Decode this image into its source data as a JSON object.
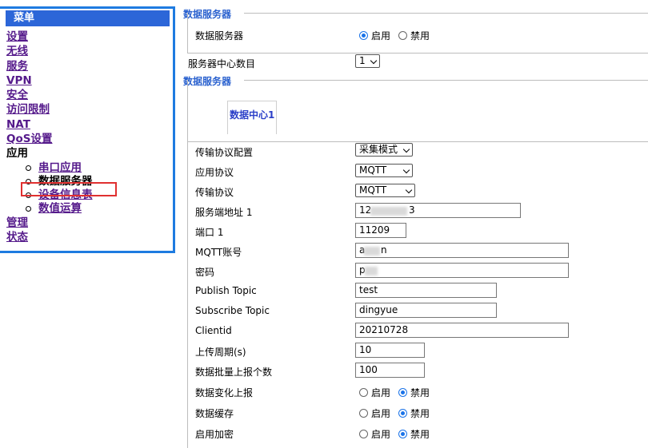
{
  "menu": {
    "title": "菜单",
    "items": [
      {
        "label": "设置"
      },
      {
        "label": "无线"
      },
      {
        "label": "服务"
      },
      {
        "label": "VPN"
      },
      {
        "label": "安全"
      },
      {
        "label": "访问限制"
      },
      {
        "label": "NAT"
      },
      {
        "label": "QoS设置"
      },
      {
        "label": "应用"
      }
    ],
    "sub_items": [
      {
        "label": "串口应用"
      },
      {
        "label": "数据服务器"
      },
      {
        "label": "设备信息表"
      },
      {
        "label": "数值运算"
      }
    ],
    "bottom_items": [
      {
        "label": "管理"
      },
      {
        "label": "状态"
      }
    ]
  },
  "section1": {
    "legend": "数据服务器",
    "server_label": "数据服务器",
    "enable_label": "启用",
    "disable_label": "禁用"
  },
  "center_count": {
    "label": "服务器中心数目",
    "value": "1"
  },
  "section2": {
    "legend": "数据服务器",
    "tab": "数据中心1"
  },
  "form": {
    "transport_config": {
      "label": "传输协议配置",
      "value": "采集模式"
    },
    "app_protocol": {
      "label": "应用协议",
      "value": "MQTT"
    },
    "transport_protocol": {
      "label": "传输协议",
      "value": "MQTT"
    },
    "server_address": {
      "label": "服务端地址 1",
      "value_start": "12",
      "value_end": "3"
    },
    "port": {
      "label": "端口 1",
      "value": "11209"
    },
    "mqtt_account": {
      "label": "MQTT账号",
      "value_start": "a",
      "value_end": "n"
    },
    "password": {
      "label": "密码",
      "value_start": "p"
    },
    "publish_topic": {
      "label": "Publish Topic",
      "value": "test"
    },
    "subscribe_topic": {
      "label": "Subscribe Topic",
      "value": "dingyue"
    },
    "clientid": {
      "label": "Clientid",
      "value": "20210728"
    },
    "upload_period": {
      "label": "上传周期(s)",
      "value": "10"
    },
    "batch_count": {
      "label": "数据批量上报个数",
      "value": "100"
    },
    "change_report": {
      "label": "数据变化上报"
    },
    "data_cache": {
      "label": "数据缓存"
    },
    "encryption": {
      "label": "启用加密"
    },
    "enable_label": "启用",
    "disable_label": "禁用"
  },
  "colors": {
    "menu_border": "#1e7be0",
    "menu_header": "#2c66d8",
    "legend": "#2b62cf",
    "highlight": "#e03030",
    "radio_on": "#1a73e8"
  }
}
